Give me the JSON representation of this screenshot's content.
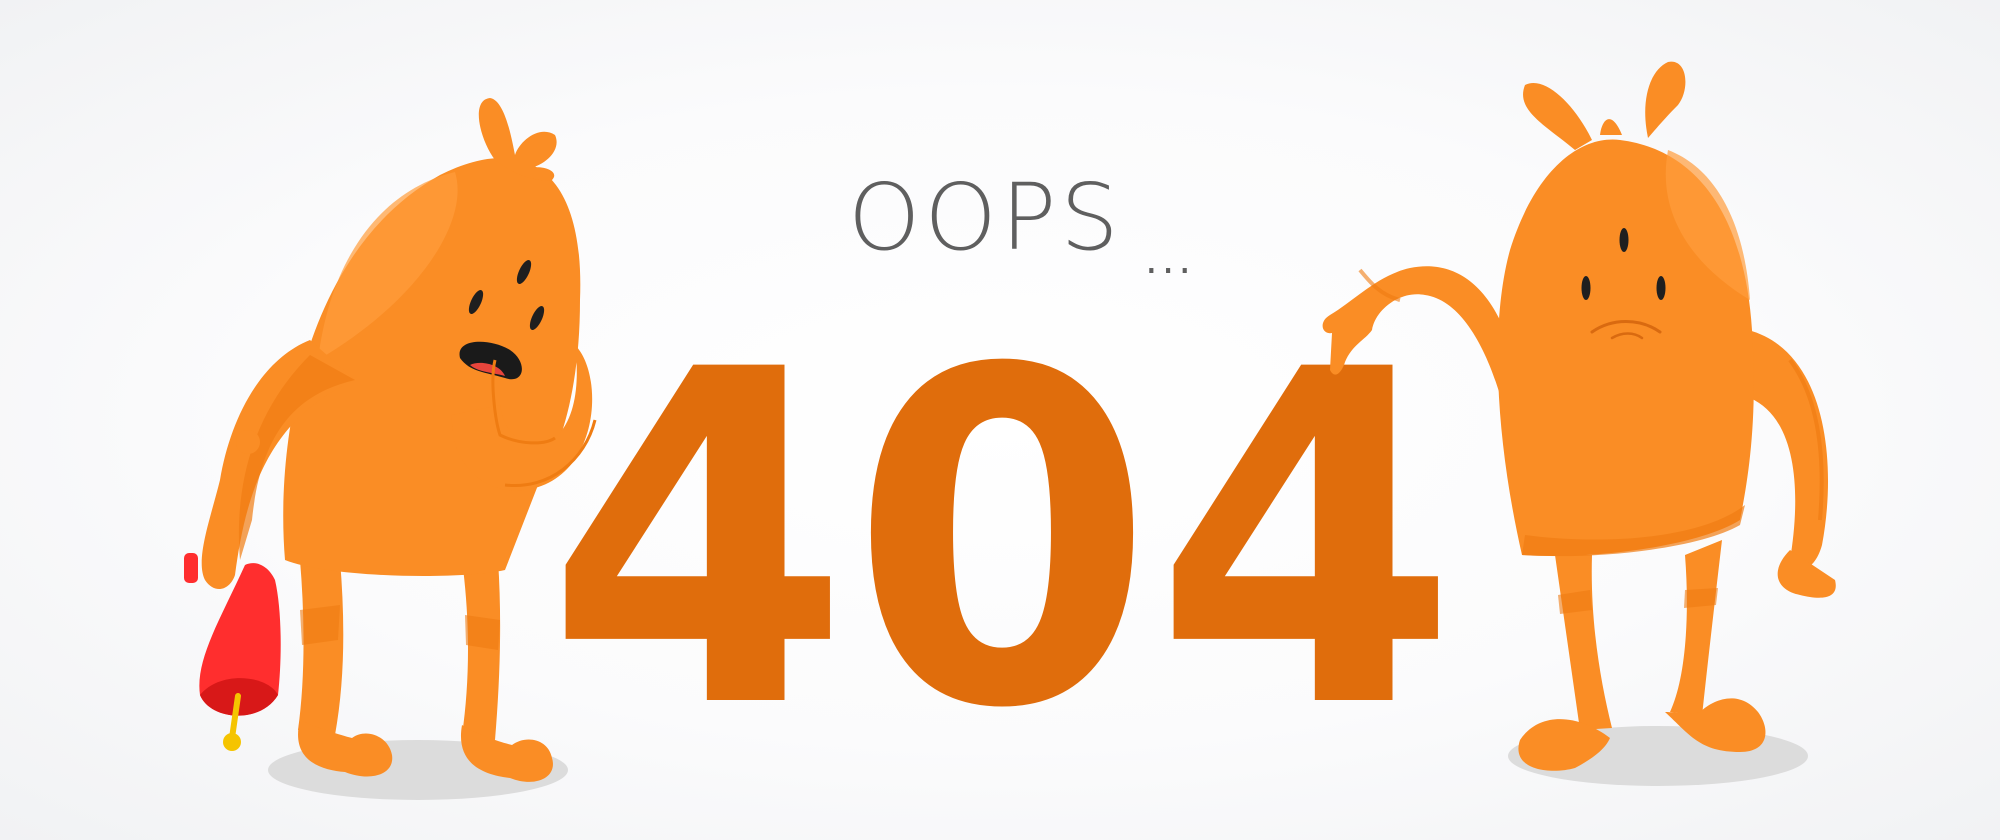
{
  "heading": "OOPS",
  "ellipsis": "...",
  "error_code": "404",
  "colors": {
    "code": "#e06d0c",
    "monster_body": "#fa8d25",
    "monster_shade": "#ef7c12",
    "bell": "#ff2e2e",
    "text": "#5f5f5f"
  },
  "icons": {
    "left_character": "orange-monster-with-bell-icon",
    "right_character": "orange-monster-pointing-icon",
    "bell": "red-bell-icon"
  }
}
